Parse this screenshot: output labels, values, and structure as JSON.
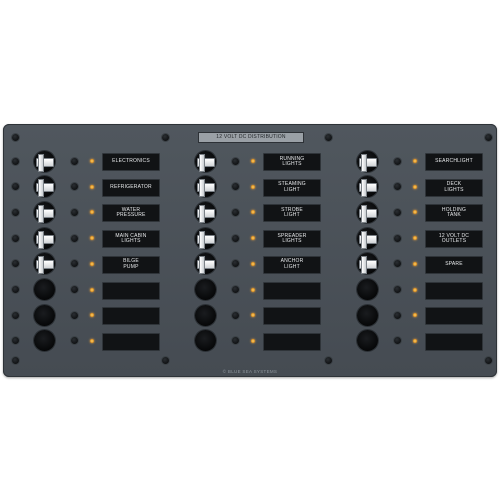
{
  "panel": {
    "title": "12 VOLT DC DISTRIBUTION",
    "footer": "© BLUE SEA SYSTEMS",
    "indicator_color": "#e59a2a",
    "columns": [
      {
        "circuits": [
          {
            "label": [
              "ELECTRONICS"
            ],
            "has_breaker": true
          },
          {
            "label": [
              "REFRIGERATOR"
            ],
            "has_breaker": true
          },
          {
            "label": [
              "WATER",
              "PRESSURE"
            ],
            "has_breaker": true
          },
          {
            "label": [
              "MAIN CABIN",
              "LIGHTS"
            ],
            "has_breaker": true
          },
          {
            "label": [
              "BILGE",
              "PUMP"
            ],
            "has_breaker": true
          },
          {
            "label": [],
            "has_breaker": false
          },
          {
            "label": [],
            "has_breaker": false
          },
          {
            "label": [],
            "has_breaker": false
          }
        ]
      },
      {
        "circuits": [
          {
            "label": [
              "RUNNING",
              "LIGHTS"
            ],
            "has_breaker": true
          },
          {
            "label": [
              "STEAMING",
              "LIGHT"
            ],
            "has_breaker": true
          },
          {
            "label": [
              "STROBE",
              "LIGHT"
            ],
            "has_breaker": true
          },
          {
            "label": [
              "SPREADER",
              "LIGHTS"
            ],
            "has_breaker": true
          },
          {
            "label": [
              "ANCHOR",
              "LIGHT"
            ],
            "has_breaker": true
          },
          {
            "label": [],
            "has_breaker": false
          },
          {
            "label": [],
            "has_breaker": false
          },
          {
            "label": [],
            "has_breaker": false
          }
        ]
      },
      {
        "circuits": [
          {
            "label": [
              "SEARCHLIGHT"
            ],
            "has_breaker": true
          },
          {
            "label": [
              "DECK",
              "LIGHTS"
            ],
            "has_breaker": true
          },
          {
            "label": [
              "HOLDING",
              "TANK"
            ],
            "has_breaker": true
          },
          {
            "label": [
              "12 VOLT DC",
              "OUTLETS"
            ],
            "has_breaker": true
          },
          {
            "label": [
              "SPARE"
            ],
            "has_breaker": true
          },
          {
            "label": [],
            "has_breaker": false
          },
          {
            "label": [],
            "has_breaker": false
          },
          {
            "label": [],
            "has_breaker": false
          }
        ]
      }
    ]
  }
}
